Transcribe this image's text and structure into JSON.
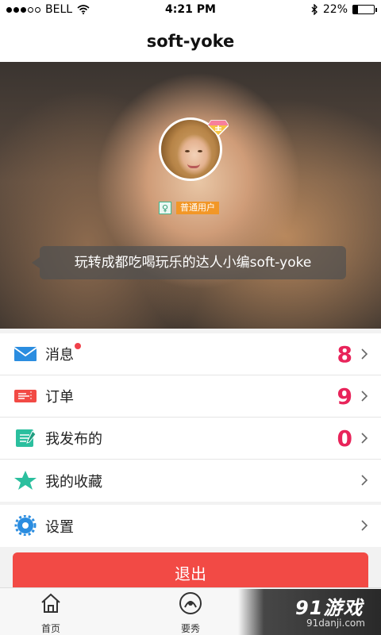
{
  "status_bar": {
    "carrier": "BELL",
    "time": "4:21 PM",
    "battery": "22%",
    "battery_level": 0.22
  },
  "header": {
    "title": "soft-yoke"
  },
  "profile": {
    "badge": "普通用户",
    "gender_icon": "female-icon",
    "bio": "玩转成都吃喝玩乐的达人小编soft-yoke"
  },
  "menu": {
    "messages": {
      "label": "消息",
      "count": "8",
      "icon": "mail-icon"
    },
    "orders": {
      "label": "订单",
      "count": "9",
      "icon": "ticket-icon"
    },
    "published": {
      "label": "我发布的",
      "count": "0",
      "icon": "notebook-icon"
    },
    "favorites": {
      "label": "我的收藏",
      "icon": "star-icon"
    },
    "settings": {
      "label": "设置",
      "icon": "gear-icon"
    }
  },
  "logout": {
    "label": "退出"
  },
  "tab_bar": {
    "home": {
      "label": "首页"
    },
    "show": {
      "label": "要秀"
    }
  },
  "watermark": {
    "logo": "91游戏",
    "url": "91danji.com"
  },
  "colors": {
    "accent_red": "#e8245a",
    "logout_red": "#f24a45",
    "badge_orange": "#f29727"
  }
}
